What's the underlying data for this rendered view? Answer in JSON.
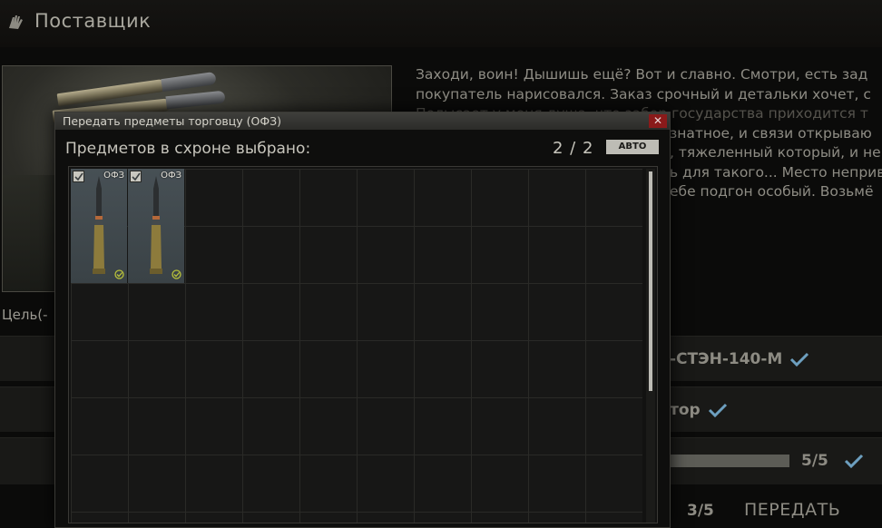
{
  "header": {
    "title": "Поставщик",
    "icon": "hand-icon"
  },
  "trader": {
    "caption": "Цель(-",
    "dialog_lines": [
      "Заходи, воин! Дышишь ещё? Вот и славно. Смотри, есть зад",
      "покупатель нарисовался. Заказ срочный и детальки хочет, с",
      "Полысает у меня душа, что забор государства приходится т",
      "знатное, и связи открываю",
      ", тяжеленный который, и не",
      "ь для такого... Место неприв",
      "ебе подгон особый. Возьмё"
    ]
  },
  "objectives": [
    {
      "text": "-СТЭН-140-М"
    },
    {
      "text": "тор"
    },
    {
      "text": "5/5",
      "progress": 1.0
    }
  ],
  "submit": {
    "count": "3/5",
    "label": "ПЕРЕДАТЬ"
  },
  "dialog": {
    "title": "Передать предметы торговцу (ОФЗ)",
    "close_label": "✕",
    "selected_label": "Предметов в схроне выбрано:",
    "selected_count": "2 / 2",
    "auto_button": "АВТО",
    "items": [
      {
        "label": "ОФЗ",
        "checked": true,
        "icon": "shell-icon"
      },
      {
        "label": "ОФЗ",
        "checked": true,
        "icon": "shell-icon"
      }
    ]
  },
  "colors": {
    "accent_check": "#6d9fbf",
    "item_check": "#b9c23a",
    "close_button": "#8a1a1a"
  }
}
